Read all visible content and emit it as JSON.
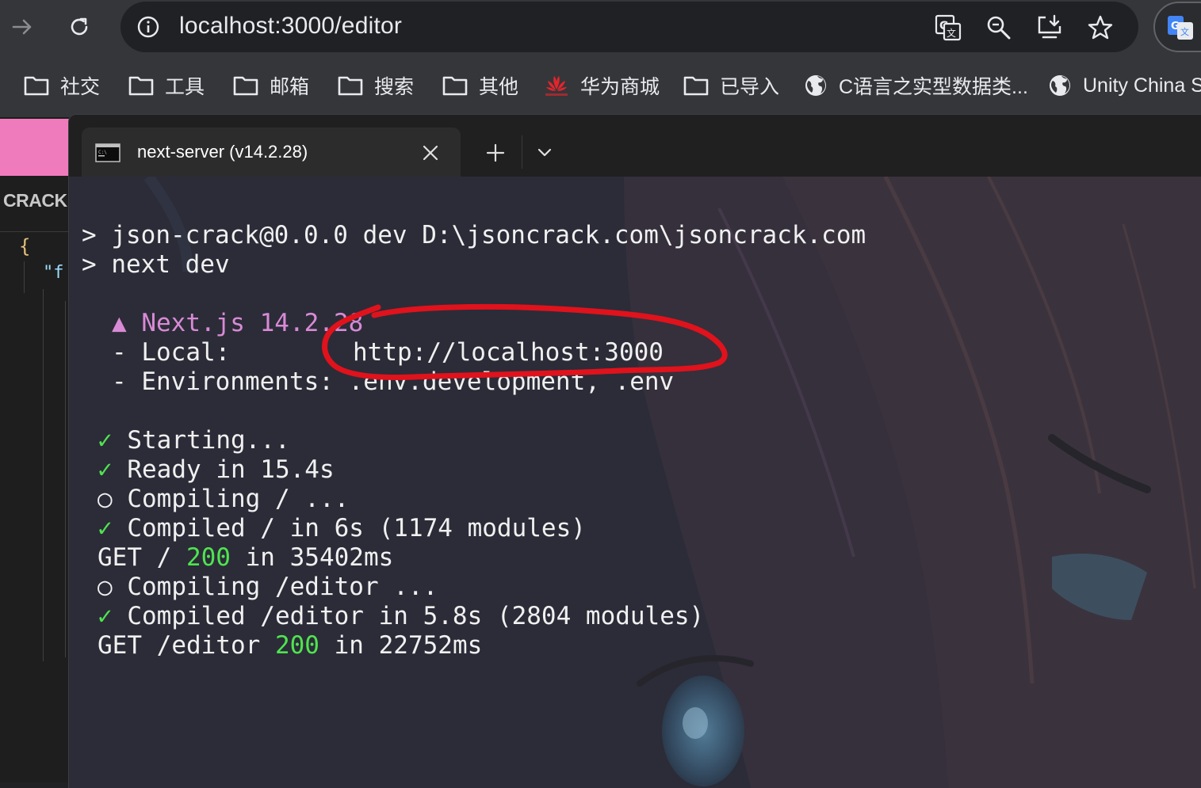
{
  "browser": {
    "url": "localhost:3000/editor",
    "accent": "#35363a"
  },
  "bookmarks": [
    {
      "label": "社交",
      "icon": "folder-icon"
    },
    {
      "label": "工具",
      "icon": "folder-icon"
    },
    {
      "label": "邮箱",
      "icon": "folder-icon"
    },
    {
      "label": "搜索",
      "icon": "folder-icon"
    },
    {
      "label": "其他",
      "icon": "folder-icon"
    },
    {
      "label": "华为商城",
      "icon": "huawei-logo-icon"
    },
    {
      "label": "已导入",
      "icon": "folder-icon"
    },
    {
      "label": "C语言之实型数据类...",
      "icon": "globe-icon"
    },
    {
      "label": "Unity China S",
      "icon": "globe-icon"
    }
  ],
  "page": {
    "logo_text": "CRACK",
    "code_brace": "{",
    "code_key": "\"f"
  },
  "terminal": {
    "tab_title": "next-server (v14.2.28)",
    "lines": {
      "l1": "> json-crack@0.0.0 dev D:\\jsoncrack.com\\jsoncrack.com",
      "l2": "> next dev",
      "l3": "▲ Next.js 14.2.28",
      "l4_label": "- Local:",
      "l4_value": "http://localhost:3000",
      "l5": "- Environments: .env.development, .env",
      "l6_mark": "✓",
      "l6_text": " Starting...",
      "l7_mark": "✓",
      "l7_text": " Ready in 15.4s",
      "l8": "○ Compiling / ...",
      "l9_mark": "✓",
      "l9_text": " Compiled / in 6s (1174 modules)",
      "l10_a": "GET / ",
      "l10_status": "200",
      "l10_b": " in 35402ms",
      "l11": "○ Compiling /editor ...",
      "l12_mark": "✓",
      "l12_text": " Compiled /editor in 5.8s (2804 modules)",
      "l13_a": "GET /editor ",
      "l13_status": "200",
      "l13_b": " in 22752ms"
    }
  }
}
